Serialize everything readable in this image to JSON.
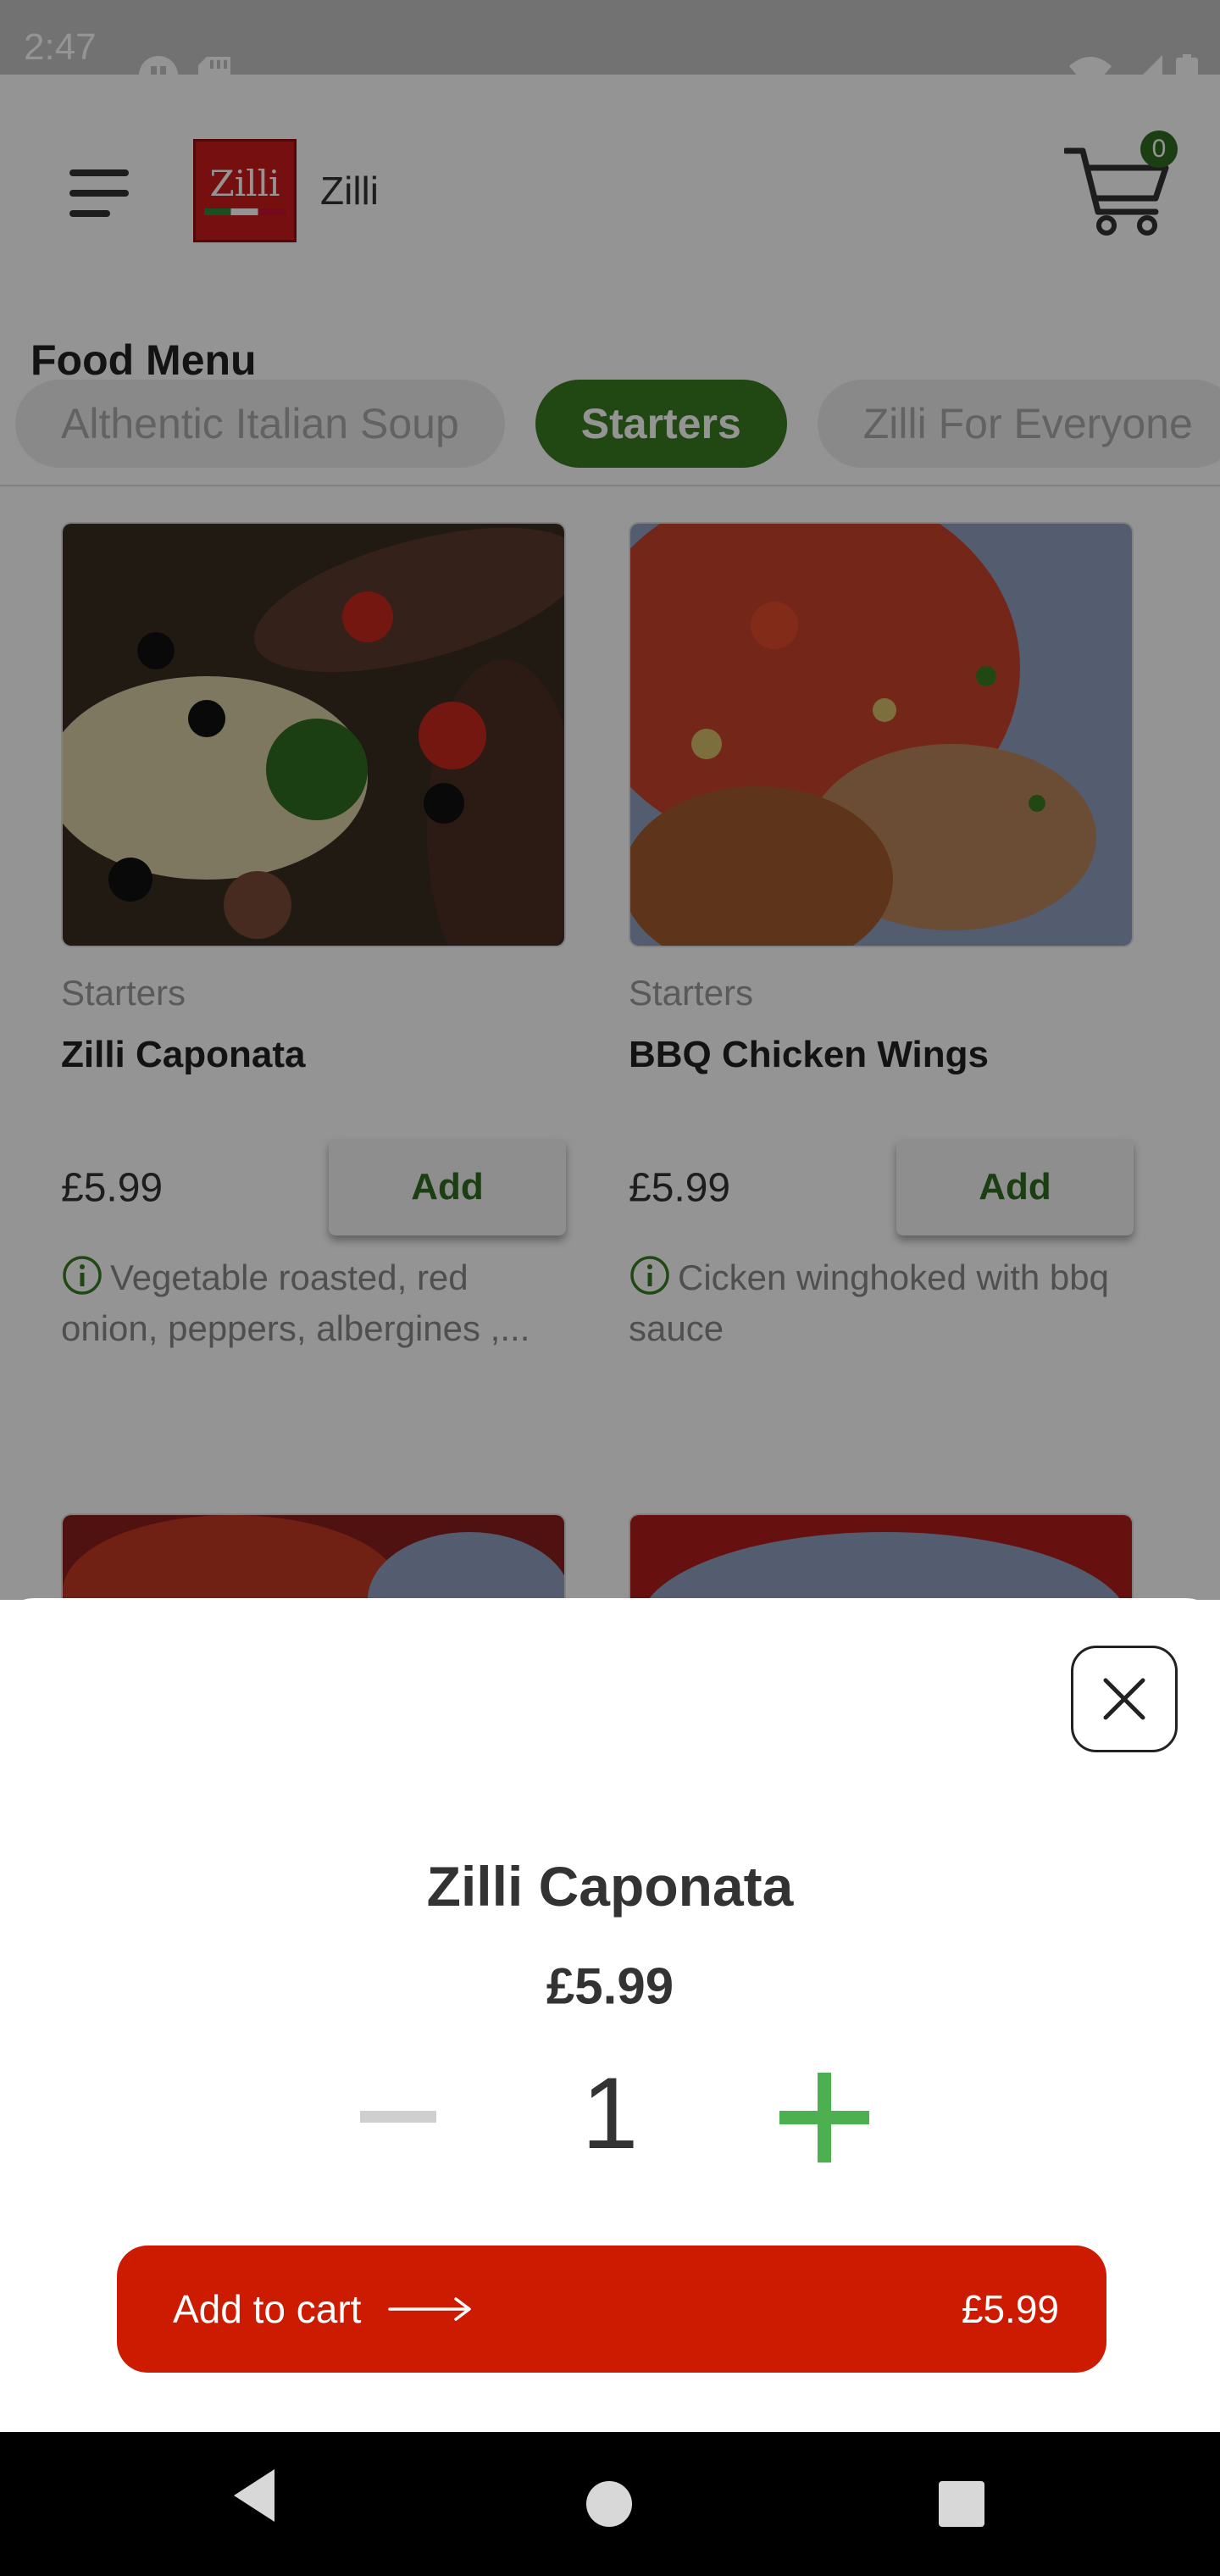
{
  "status_bar": {
    "time": "2:47"
  },
  "header": {
    "brand_name": "Zilli",
    "logo_text": "Zilli",
    "cart_count": "0"
  },
  "menu": {
    "title": "Food Menu",
    "categories": [
      {
        "label": "Althentic Italian Soup",
        "active": false
      },
      {
        "label": "Starters",
        "active": true
      },
      {
        "label": "Zilli For Everyone",
        "active": false
      }
    ]
  },
  "products": [
    {
      "category": "Starters",
      "name": "Zilli Caponata",
      "price": "£5.99",
      "add_label": "Add",
      "description": "Vegetable roasted, red onion, peppers, albergines ,..."
    },
    {
      "category": "Starters",
      "name": "BBQ Chicken Wings",
      "price": "£5.99",
      "add_label": "Add",
      "description": "Cicken winghoked with bbq sauce"
    }
  ],
  "sheet": {
    "name": "Zilli Caponata",
    "price": "£5.99",
    "quantity": "1",
    "cta_label": "Add to cart",
    "cta_price": "£5.99"
  },
  "colors": {
    "brand_red": "#cc1b00",
    "brand_green": "#3a7d22",
    "plus_green": "#4caf50"
  },
  "icons": [
    "menu-icon",
    "cart-icon",
    "info-icon",
    "close-icon",
    "minus-icon",
    "plus-icon",
    "arrow-right-icon"
  ]
}
